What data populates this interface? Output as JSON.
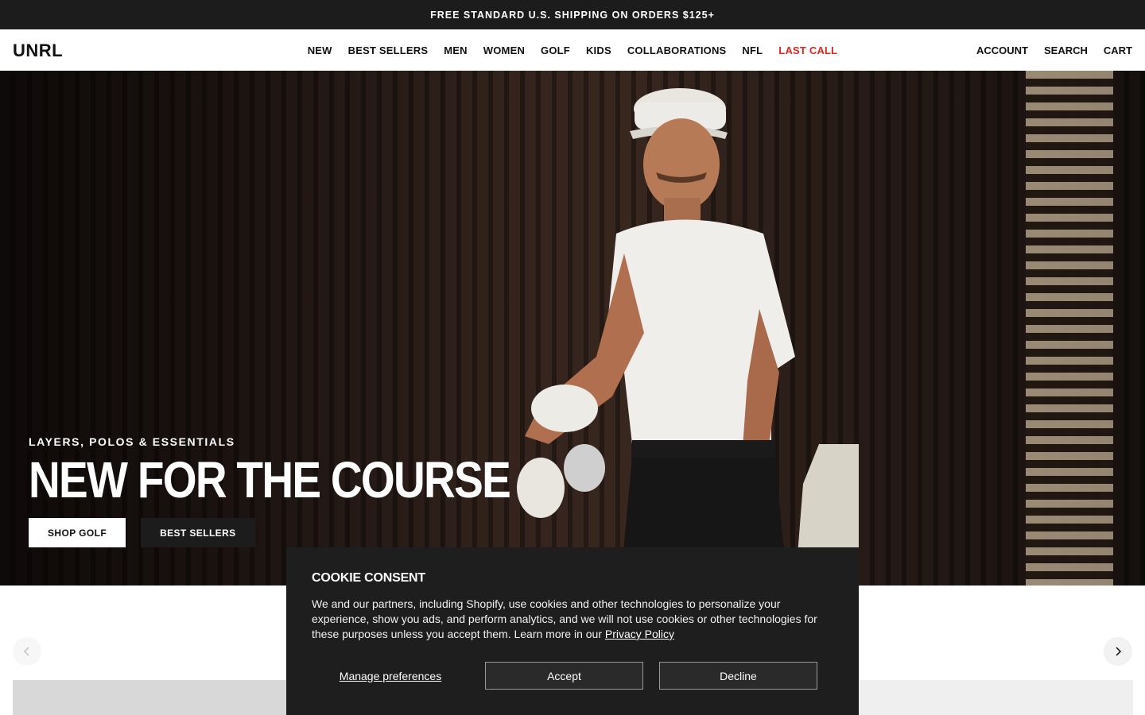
{
  "announcement": {
    "text": "FREE STANDARD U.S. SHIPPING ON ORDERS $125+"
  },
  "header": {
    "logo_text": "UNRL",
    "nav": [
      {
        "label": "NEW"
      },
      {
        "label": "BEST SELLERS"
      },
      {
        "label": "MEN"
      },
      {
        "label": "WOMEN"
      },
      {
        "label": "GOLF"
      },
      {
        "label": "KIDS"
      },
      {
        "label": "COLLABORATIONS"
      },
      {
        "label": "NFL"
      },
      {
        "label": "LAST CALL"
      }
    ],
    "account_label": "ACCOUNT",
    "search_label": "SEARCH",
    "cart_label": "CART"
  },
  "hero": {
    "eyebrow": "LAYERS, POLOS & ESSENTIALS",
    "headline": "NEW FOR THE COURSE",
    "primary_cta": "SHOP GOLF",
    "secondary_cta": "BEST SELLERS"
  },
  "cookie_consent": {
    "title": "COOKIE CONSENT",
    "body": "We and our partners, including Shopify, use cookies and other technologies to personalize your experience, show you ads, and perform analytics, and we will not use cookies or other technologies for these purposes unless you accept them. Learn more in our",
    "privacy_link": "Privacy Policy",
    "manage_label": "Manage preferences",
    "accept_label": "Accept",
    "decline_label": "Decline"
  },
  "colors": {
    "announcement_bg": "#1c1c1c",
    "last_call": "#e0261e",
    "cookie_bg": "#1e1e1e"
  },
  "icons": [
    "chevron-left-icon",
    "chevron-right-icon"
  ]
}
